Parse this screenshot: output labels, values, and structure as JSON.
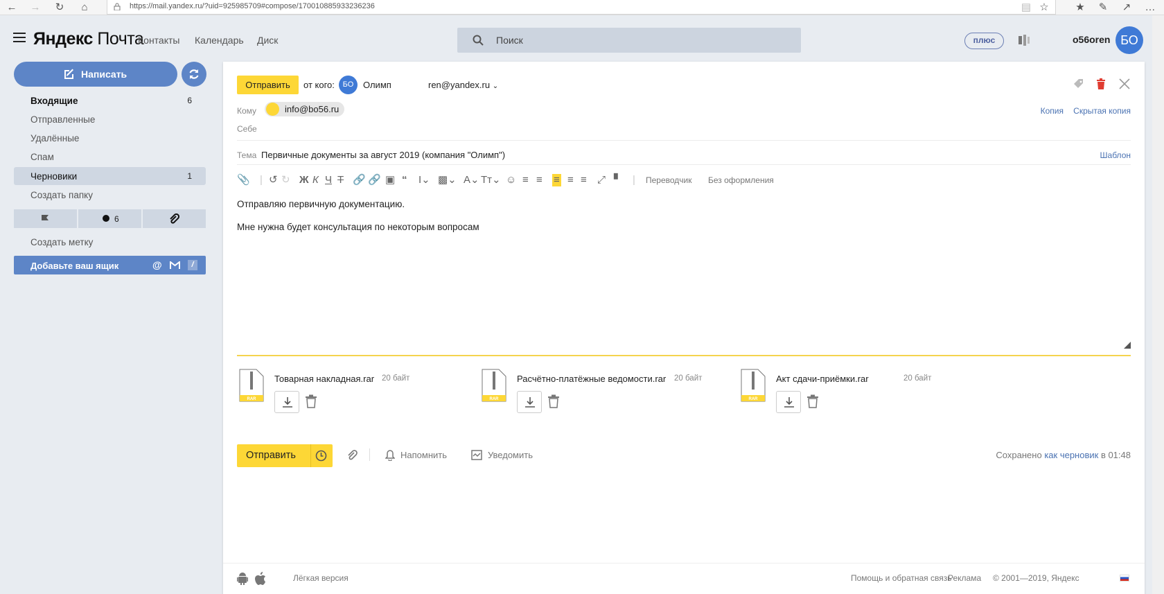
{
  "browser": {
    "url": "https://mail.yandex.ru/?uid=925985709#compose/170010885933236236"
  },
  "header": {
    "logo_bold": "Яндекс",
    "logo_light": "Почта",
    "nav": [
      "Контакты",
      "Календарь",
      "Диск"
    ],
    "search_placeholder": "Поиск",
    "plus_label": "плюс",
    "username": "o56oren",
    "avatar_initials": "БО"
  },
  "sidebar": {
    "compose_label": "Написать",
    "folders": [
      {
        "label": "Входящие",
        "count": "6"
      },
      {
        "label": "Отправленные",
        "count": ""
      },
      {
        "label": "Удалённые",
        "count": ""
      },
      {
        "label": "Спам",
        "count": ""
      },
      {
        "label": "Черновики",
        "count": "1"
      }
    ],
    "create_folder": "Создать папку",
    "unread_count": "6",
    "create_label": "Создать метку",
    "add_mailbox": "Добавьте ваш ящик"
  },
  "compose": {
    "send_label": "Отправить",
    "from_label": "от кого:",
    "from_initials": "БО",
    "from_name": "Олимп",
    "from_email": "ren@yandex.ru",
    "to_label": "Кому",
    "recipient": "info@bo56.ru",
    "cc_label": "Копия",
    "bcc_label": "Скрытая копия",
    "self_label": "Себе",
    "subject_label": "Тема",
    "subject": "Первичные документы за август 2019 (компания \"Олимп\")",
    "template_label": "Шаблон",
    "translator_label": "Переводчик",
    "plain_label": "Без оформления",
    "body_lines": [
      "Отправляю первичную документацию.",
      "Мне нужна будет консультация по некоторым вопросам"
    ],
    "attachments": [
      {
        "name": "Товарная накладная.rar",
        "size": "20 байт",
        "type": "RAR"
      },
      {
        "name": "Расчётно-платёжные ведомости.rar",
        "size": "20 байт",
        "type": "RAR"
      },
      {
        "name": "Акт сдачи-приёмки.rar",
        "size": "20 байт",
        "type": "RAR"
      }
    ],
    "remind_label": "Напомнить",
    "notify_label": "Уведомить",
    "saved_prefix": "Сохранено",
    "saved_link": "как черновик",
    "saved_suffix": "в 01:48"
  },
  "footer": {
    "light_version": "Лёгкая версия",
    "help": "Помощь и обратная связь",
    "ads": "Реклама",
    "copyright": "© 2001—2019, Яндекс"
  },
  "colors": {
    "accent_yellow": "#fdd736",
    "sidebar_blue": "#5d85c7",
    "avatar_blue": "#3f7ad6",
    "link_blue": "#4a72b2"
  }
}
